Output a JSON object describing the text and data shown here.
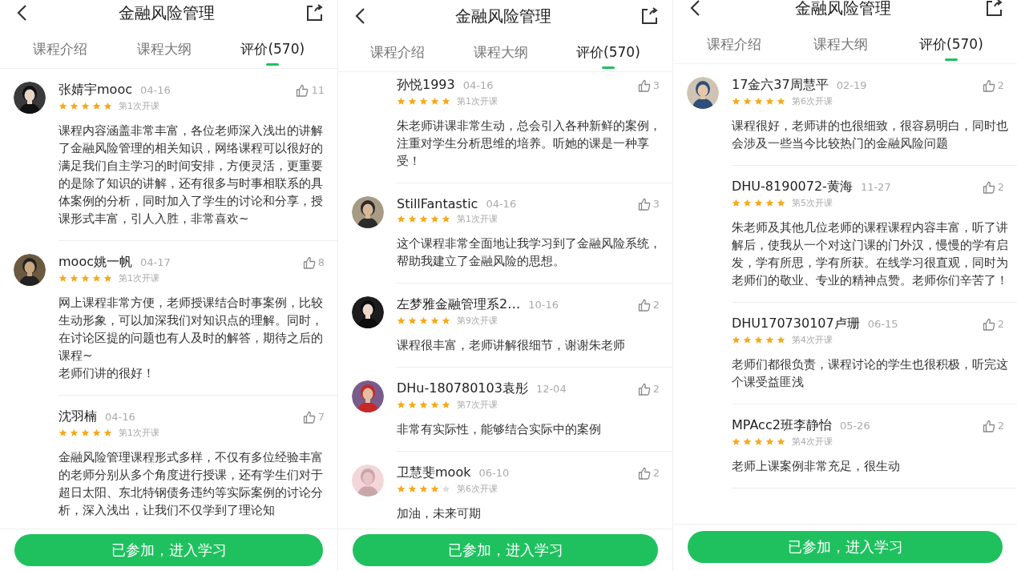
{
  "panels": [
    {
      "title": "金融风险管理",
      "tabs": [
        {
          "label": "课程介绍",
          "selected": false
        },
        {
          "label": "课程大纲",
          "selected": false
        },
        {
          "label": "评价(570)",
          "selected": true
        }
      ],
      "reviews": [
        {
          "name": "张婧宇mooc",
          "date": "04-16",
          "stars": 5,
          "session": "第1次开课",
          "likes": "11",
          "text": "课程内容涵盖非常丰富，各位老师深入浅出的讲解了金融风险管理的相关知识，网络课程可以很好的满足我们自主学习的时间安排，方便灵活，更重要的是除了知识的讲解，还有很多与时事相联系的具体案例的分析，同时加入了学生的讨论和分享，授课形式丰富，引人入胜，非常喜欢~"
        },
        {
          "name": "mooc姚一帆",
          "date": "04-17",
          "stars": 5,
          "session": "第1次开课",
          "likes": "8",
          "text": "网上课程非常方便，老师授课结合时事案例，比较生动形象，可以加深我们对知识点的理解。同时，在讨论区提的问题也有人及时的解答，期待之后的课程~\n老师们讲的很好！"
        },
        {
          "name": "沈羽楠",
          "date": "04-16",
          "stars": 5,
          "session": "第1次开课",
          "likes": "7",
          "text": "金融风险管理课程形式多样，不仅有多位经验丰富的老师分别从多个角度进行授课，还有学生们对于超日太阳、东北特钢债务违约等实际案例的讨论分析，深入浅出，让我们不仅学到了理论知"
        }
      ],
      "button": "已参加，进入学习"
    },
    {
      "title": "金融风险管理",
      "tabs": [
        {
          "label": "课程介绍",
          "selected": false
        },
        {
          "label": "课程大纲",
          "selected": false
        },
        {
          "label": "评价(570)",
          "selected": true
        }
      ],
      "reviews": [
        {
          "name": "孙悦1993",
          "date": "04-16",
          "stars": 5,
          "session": "第1次开课",
          "likes": "3",
          "text": "朱老师讲课非常生动，总会引入各种新鲜的案例，注重对学生分析思维的培养。听她的课是一种享受！"
        },
        {
          "name": "StillFantastic",
          "date": "04-16",
          "stars": 5,
          "session": "第1次开课",
          "likes": "3",
          "text": "这个课程非常全面地让我学习到了金融风险系统，帮助我建立了金融风险的思想。"
        },
        {
          "name": "左梦雅金融管理系2…",
          "date": "10-16",
          "stars": 5,
          "session": "第9次开课",
          "likes": "2",
          "text": "课程很丰富，老师讲解很细节，谢谢朱老师"
        },
        {
          "name": "DHu-180780103袁彤",
          "date": "12-04",
          "stars": 5,
          "session": "第7次开课",
          "likes": "2",
          "text": "非常有实际性，能够结合实际中的案例"
        },
        {
          "name": "卫慧斐mook",
          "date": "06-10",
          "stars": 4,
          "session": "第6次开课",
          "likes": "2",
          "text": "加油，未来可期"
        }
      ],
      "button": "已参加，进入学习"
    },
    {
      "title": "金融风险管理",
      "tabs": [
        {
          "label": "课程介绍",
          "selected": false
        },
        {
          "label": "课程大纲",
          "selected": false
        },
        {
          "label": "评价(570)",
          "selected": true
        }
      ],
      "reviews": [
        {
          "name": "17金六37周慧平",
          "date": "02-19",
          "stars": 5,
          "session": "第6次开课",
          "likes": "2",
          "text": "课程很好，老师讲的也很细致，很容易明白，同时也会涉及一些当今比较热门的金融风险问题"
        },
        {
          "name": "DHU-8190072-黄海",
          "date": "11-27",
          "stars": 5,
          "session": "第5次开课",
          "likes": "2",
          "text": "朱老师及其他几位老师的课程课程内容丰富，听了讲解后，使我从一个对这门课的门外汉，慢慢的学有启发，学有所思，学有所获。在线学习很直观，同时为老师们的敬业、专业的精神点赞。老师你们辛苦了！"
        },
        {
          "name": "DHU170730107卢珊",
          "date": "06-15",
          "stars": 5,
          "session": "第4次开课",
          "likes": "2",
          "text": "老师们都很负责，课程讨论的学生也很积极，听完这个课受益匪浅"
        },
        {
          "name": "MPAcc2班李静怡",
          "date": "05-26",
          "stars": 5,
          "session": "第4次开课",
          "likes": "2",
          "text": "老师上课案例非常充足，很生动"
        }
      ],
      "button": "已参加，进入学习"
    }
  ]
}
